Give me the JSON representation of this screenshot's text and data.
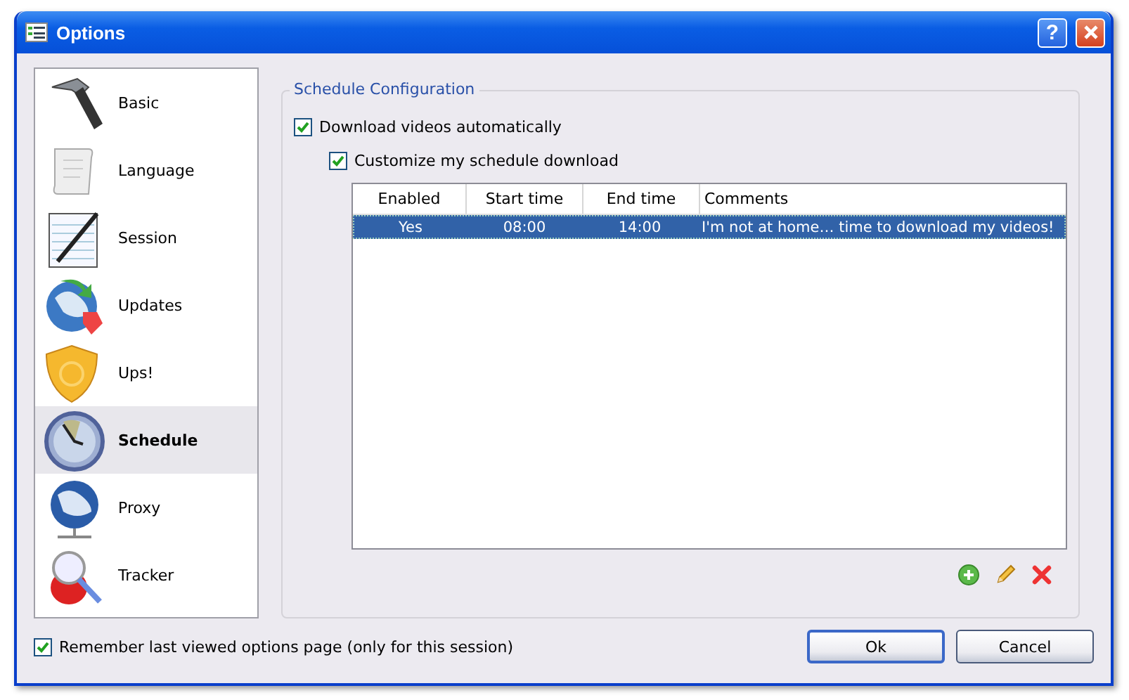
{
  "window": {
    "title": "Options",
    "help": "?"
  },
  "sidebar": {
    "items": [
      {
        "label": "Basic",
        "selected": false
      },
      {
        "label": "Language",
        "selected": false
      },
      {
        "label": "Session",
        "selected": false
      },
      {
        "label": "Updates",
        "selected": false
      },
      {
        "label": "Ups!",
        "selected": false
      },
      {
        "label": "Schedule",
        "selected": true
      },
      {
        "label": "Proxy",
        "selected": false
      },
      {
        "label": "Tracker",
        "selected": false
      }
    ]
  },
  "group": {
    "title": "Schedule Configuration",
    "options": [
      {
        "label": "Download videos automatically",
        "checked": true
      },
      {
        "label": "Customize my schedule download",
        "checked": true
      }
    ],
    "table": {
      "columns": [
        "Enabled",
        "Start time",
        "End time",
        "Comments"
      ],
      "rows": [
        {
          "selected": true,
          "cells": [
            "Yes",
            "08:00",
            "14:00",
            "I'm not at home… time to download my videos!"
          ]
        }
      ]
    }
  },
  "remember": {
    "label": "Remember last viewed options page (only for this session)",
    "checked": true
  },
  "buttons": [
    {
      "label": "Ok",
      "default": true
    },
    {
      "label": "Cancel",
      "default": false
    }
  ]
}
